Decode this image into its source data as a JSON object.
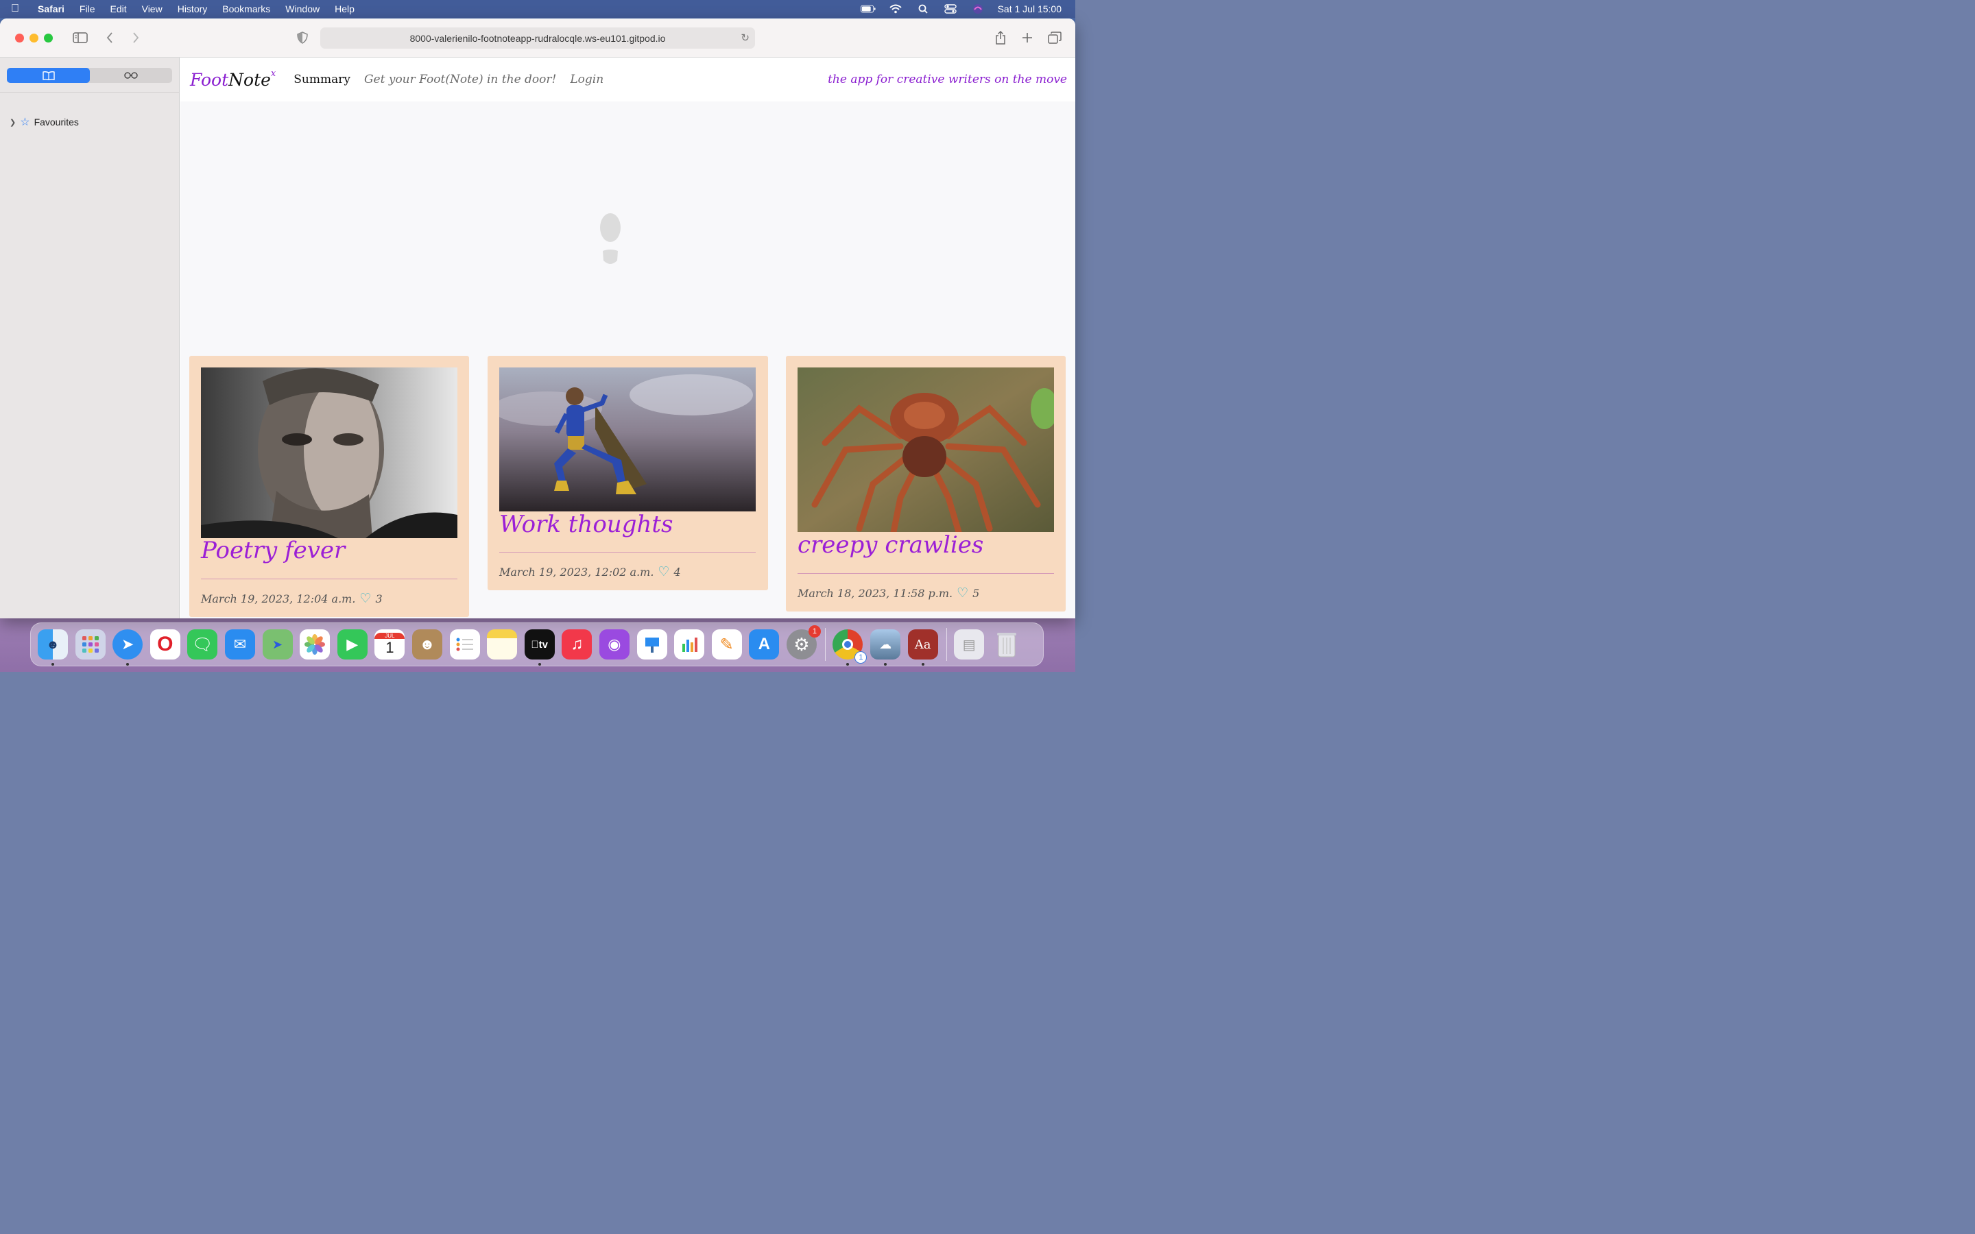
{
  "menubar": {
    "app_name": "Safari",
    "menus": [
      "File",
      "Edit",
      "View",
      "History",
      "Bookmarks",
      "Window",
      "Help"
    ],
    "clock": "Sat 1 Jul  15:00"
  },
  "browser": {
    "url": "8000-valerienilo-footnoteapp-rudralocqle.ws-eu101.gitpod.io",
    "sidebar": {
      "favourites_label": "Favourites"
    }
  },
  "site": {
    "brand": {
      "part1": "Foot",
      "part2": "Note",
      "sup": "x"
    },
    "nav": {
      "summary": "Summary",
      "get_your_foot": "Get your Foot(Note) in the door!",
      "login": "Login"
    },
    "tagline": "the app for creative writers on the move"
  },
  "cards": [
    {
      "title": "Poetry fever",
      "date": "March 19, 2023, 12:04 a.m.",
      "likes": "3",
      "image": "portrait of a man"
    },
    {
      "title": "Work thoughts",
      "date": "March 19, 2023, 12:02 a.m.",
      "likes": "4",
      "image": "superhero figure"
    },
    {
      "title": "creepy crawlies",
      "date": "March 18, 2023, 11:58 p.m.",
      "likes": "5",
      "image": "tarantula spider"
    }
  ],
  "dock": {
    "apps": [
      "Finder",
      "Launchpad",
      "Safari",
      "Opera",
      "Messages",
      "Mail",
      "Maps",
      "Photos",
      "FaceTime",
      "Calendar",
      "Contacts",
      "Reminders",
      "Notes",
      "TV",
      "Music",
      "Podcasts",
      "Keynote",
      "Numbers",
      "Pages",
      "App Store",
      "System Settings",
      "Chrome",
      "Preview",
      "Dictionary",
      "Downloads",
      "Trash"
    ],
    "calendar_month": "JUL",
    "calendar_day": "1",
    "settings_badge": "1",
    "chrome_badge": "1"
  },
  "colors": {
    "accent_purple": "#8a1ed0",
    "card_bg": "#f8dac0",
    "heart": "#35b5c7"
  }
}
